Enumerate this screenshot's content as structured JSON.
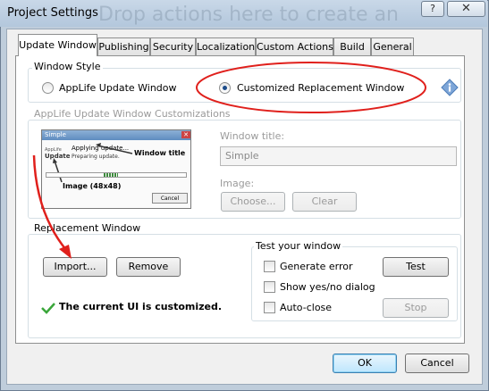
{
  "window": {
    "title": "Project Settings",
    "ghost_text": "Drop actions here to create an",
    "help_glyph": "?",
    "close_glyph": "✕"
  },
  "tabs": [
    {
      "label": "Update Window",
      "active": true
    },
    {
      "label": "Publishing"
    },
    {
      "label": "Security"
    },
    {
      "label": "Localization"
    },
    {
      "label": "Custom Actions"
    },
    {
      "label": "Build"
    },
    {
      "label": "General"
    }
  ],
  "window_style": {
    "legend": "Window Style",
    "option_applife": "AppLife Update Window",
    "option_custom": "Customized Replacement Window",
    "selected": "Customized Replacement Window"
  },
  "customizations": {
    "legend": "AppLife Update Window Customizations",
    "preview": {
      "title": "Simple",
      "applying": "Applying update...",
      "preparing": "Preparing update.",
      "logo_top": "AppLife",
      "logo_main": "Update",
      "annotation_title": "Window title",
      "annotation_image": "Image (48x48)",
      "cancel": "Cancel"
    },
    "window_title_label": "Window title:",
    "window_title_value": "Simple",
    "image_label": "Image:",
    "choose_button": "Choose...",
    "clear_button": "Clear"
  },
  "replacement": {
    "legend": "Replacement Window",
    "import_button": "Import...",
    "remove_button": "Remove",
    "status_text": "The current UI is customized."
  },
  "test": {
    "legend": "Test your window",
    "generate_error": "Generate error",
    "show_yes_no": "Show yes/no dialog",
    "auto_close": "Auto-close",
    "test_button": "Test",
    "stop_button": "Stop"
  },
  "footer": {
    "ok_button": "OK",
    "cancel_button": "Cancel"
  },
  "colors": {
    "annotation_red": "#e0201c",
    "success_green": "#3aa63a",
    "info_blue": "#7ea6d8",
    "selected_blue": "#1c4c8a"
  }
}
